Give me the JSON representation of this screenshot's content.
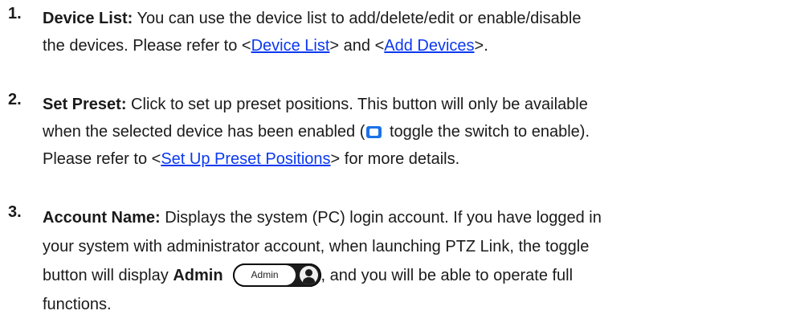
{
  "items": [
    {
      "number": "1.",
      "title": "Device List:",
      "line1": " You can use the device list to add/delete/edit or enable/disable",
      "line2_start": "the devices. Please refer to <",
      "link1": "Device List",
      "line2_mid": "> and <",
      "link2": "Add Devices",
      "line2_end": ">."
    },
    {
      "number": "2.",
      "title": "Set Preset:",
      "line1": " Click to set up preset positions. This button will only be available",
      "line2_start": "when the selected device has been enabled (",
      "line2_end": " toggle the switch to enable).",
      "line3_start": "Please refer to <",
      "link": "Set Up Preset Positions",
      "line3_end": "> for more details."
    },
    {
      "number": "3.",
      "title": "Account Name:",
      "line1": " Displays the system (PC) login account. If you have logged in",
      "line2": "your system with administrator account, when launching PTZ Link, the toggle",
      "line3_start": "button will display ",
      "line3_bold": "Admin",
      "pill_label": "Admin",
      "line3_end": ", and you will be able to operate full",
      "line4": "functions."
    }
  ],
  "colors": {
    "text": "#1a1a1a",
    "link": "#0b38f0",
    "toggle": "#1a73e8",
    "pill_bg": "#1c1c1c"
  },
  "icons": {
    "toggle": "toggle-switch-icon",
    "user": "user-circle-icon"
  }
}
